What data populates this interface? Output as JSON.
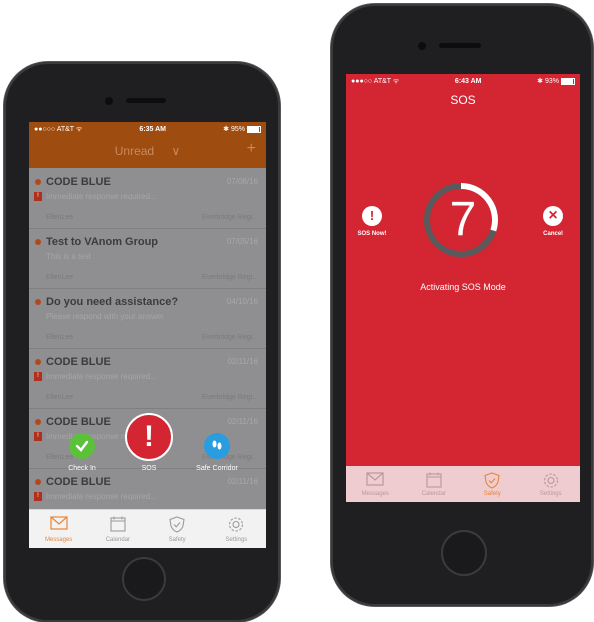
{
  "left_phone": {
    "status": {
      "carrier": "●●○○○ AT&T ᯤ",
      "time": "6:35 AM",
      "battery": "✱ 95%",
      "battery_level": 0.95
    },
    "header": {
      "title": "Unread",
      "chevron": "∨",
      "add": "+"
    },
    "messages": [
      {
        "subject": "CODE BLUE",
        "date": "07/06/16",
        "preview": "Immediate response required...",
        "sender": "EllenLee",
        "org": "Everbridge Regi...",
        "flagged": true
      },
      {
        "subject": "Test to VAnom Group",
        "date": "07/05/16",
        "preview": "This is a test",
        "sender": "EllenLee",
        "org": "Everbridge Regi...",
        "flagged": false
      },
      {
        "subject": "Do you need assistance?",
        "date": "04/10/16",
        "preview": "Please respond with your answer",
        "sender": "EllenLee",
        "org": "Everbridge Regi...",
        "flagged": false
      },
      {
        "subject": "CODE BLUE",
        "date": "02/11/16",
        "preview": "Immediate response required...",
        "sender": "EllenLee",
        "org": "Everbridge Regi...",
        "flagged": true
      },
      {
        "subject": "CODE BLUE",
        "date": "02/11/16",
        "preview": "Immediate response required...",
        "sender": "EllenLee",
        "org": "Everbridge Regi...",
        "flagged": true
      },
      {
        "subject": "CODE BLUE",
        "date": "02/11/16",
        "preview": "Immediate response required...",
        "sender": "",
        "org": "",
        "flagged": true
      }
    ],
    "actions": {
      "check_in": "Check In",
      "sos": "SOS",
      "safe_corridor": "Safe Corridor",
      "sos_symbol": "!"
    },
    "tabs": [
      {
        "label": "Messages",
        "icon": "envelope-icon",
        "active": true
      },
      {
        "label": "Calendar",
        "icon": "calendar-icon",
        "active": false
      },
      {
        "label": "Safety",
        "icon": "shield-icon",
        "active": false
      },
      {
        "label": "Settings",
        "icon": "gear-icon",
        "active": false
      }
    ]
  },
  "right_phone": {
    "status": {
      "carrier": "●●●○○ AT&T ᯤ",
      "time": "6:43 AM",
      "battery": "✱ 93%",
      "battery_level": 0.93
    },
    "title": "SOS",
    "countdown": "7",
    "countdown_progress": 0.3,
    "sos_now": {
      "symbol": "!",
      "label": "SOS Now!"
    },
    "cancel": {
      "symbol": "×",
      "label": "Cancel"
    },
    "activating_text": "Activating SOS Mode",
    "tabs": [
      {
        "label": "Messages",
        "icon": "envelope-icon",
        "active": false
      },
      {
        "label": "Calendar",
        "icon": "calendar-icon",
        "active": false
      },
      {
        "label": "Safety",
        "icon": "shield-icon",
        "active": true
      },
      {
        "label": "Settings",
        "icon": "gear-icon",
        "active": false
      }
    ]
  },
  "colors": {
    "accent_orange": "#e8843a",
    "header_orange": "#9f4c10",
    "sos_red": "#d32532",
    "check_in_green": "#5cc13a",
    "safe_corridor_blue": "#2a9de0"
  }
}
